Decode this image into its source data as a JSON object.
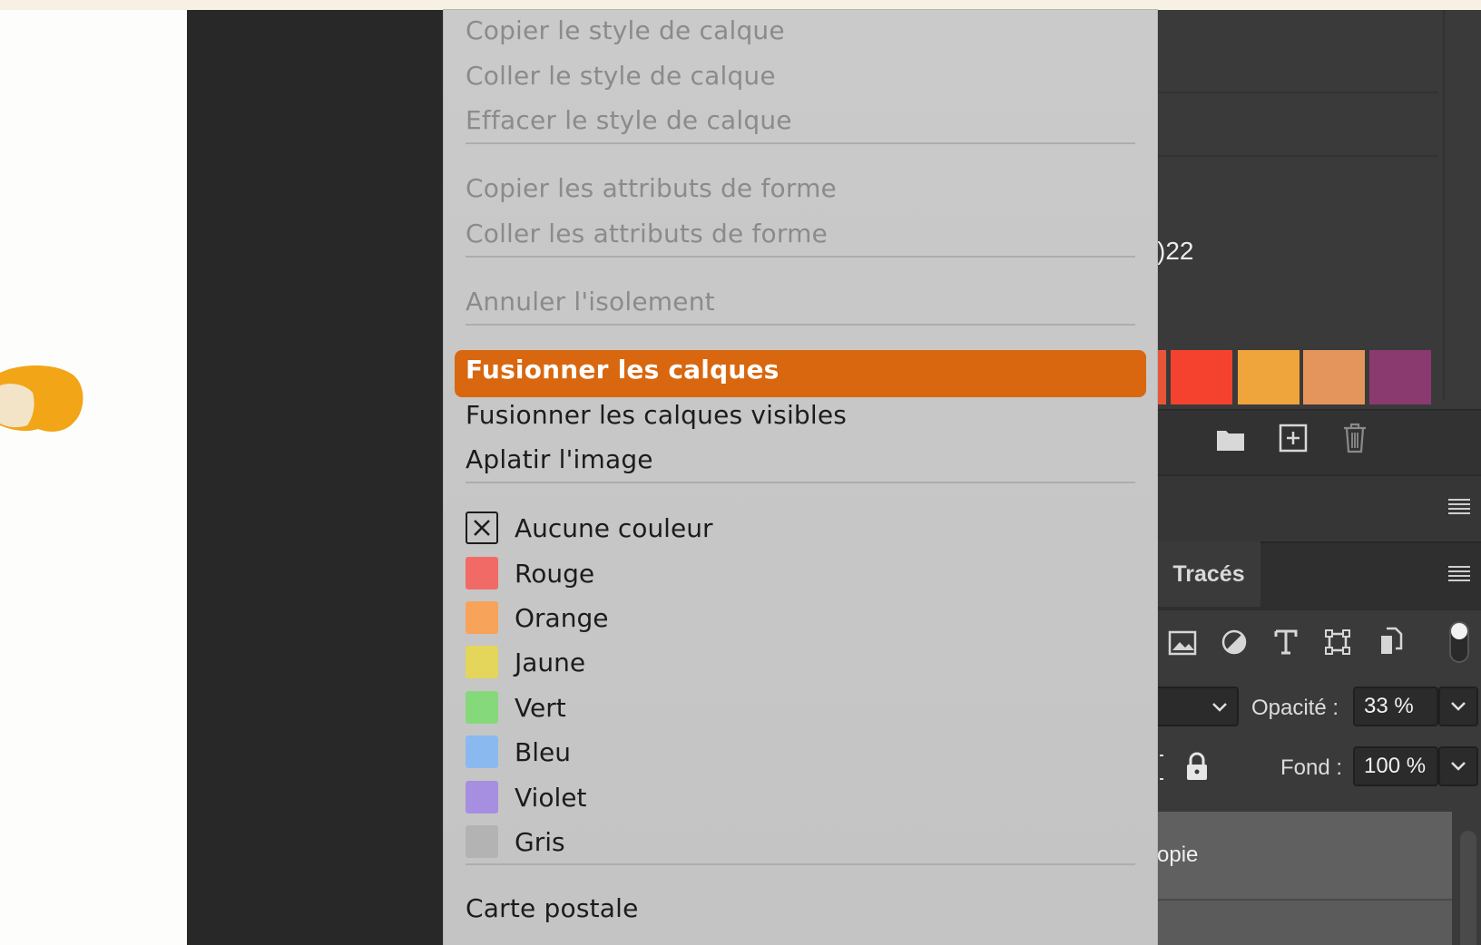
{
  "menu": {
    "items_top": [
      {
        "label": "Copier le style de calque"
      },
      {
        "label": "Coller le style de calque"
      },
      {
        "label": "Effacer le style de calque"
      }
    ],
    "items_shape": [
      {
        "label": "Copier les attributs de forme"
      },
      {
        "label": "Coller les attributs de forme"
      }
    ],
    "item_isolation": {
      "label": "Annuler l'isolement"
    },
    "items_merge": [
      {
        "label": "Fusionner les calques"
      },
      {
        "label": "Fusionner les calques visibles"
      },
      {
        "label": "Aplatir l'image"
      }
    ],
    "colors": [
      {
        "label": "Aucune couleur",
        "color": "none"
      },
      {
        "label": "Rouge",
        "color": "#f26a66"
      },
      {
        "label": "Orange",
        "color": "#f7a35a"
      },
      {
        "label": "Jaune",
        "color": "#e3d65a"
      },
      {
        "label": "Vert",
        "color": "#86d97a"
      },
      {
        "label": "Bleu",
        "color": "#8ab9f0"
      },
      {
        "label": "Violet",
        "color": "#a68fe0"
      },
      {
        "label": "Gris",
        "color": "#b3b3b3"
      }
    ],
    "item_postcard": {
      "label": "Carte postale"
    },
    "highlight_color": "#d8670f"
  },
  "panel": {
    "year_fragment": ")22",
    "swatches": [
      "#e8563a",
      "#f5422f",
      "#f0a43c",
      "#e3955c",
      "#8a3a6e"
    ],
    "tab_traces": "Tracés",
    "opacity_label": "Opacité :",
    "opacity_value": "33 %",
    "fill_label": "Fond :",
    "fill_value": "100 %",
    "layer_fragment": "opie"
  }
}
